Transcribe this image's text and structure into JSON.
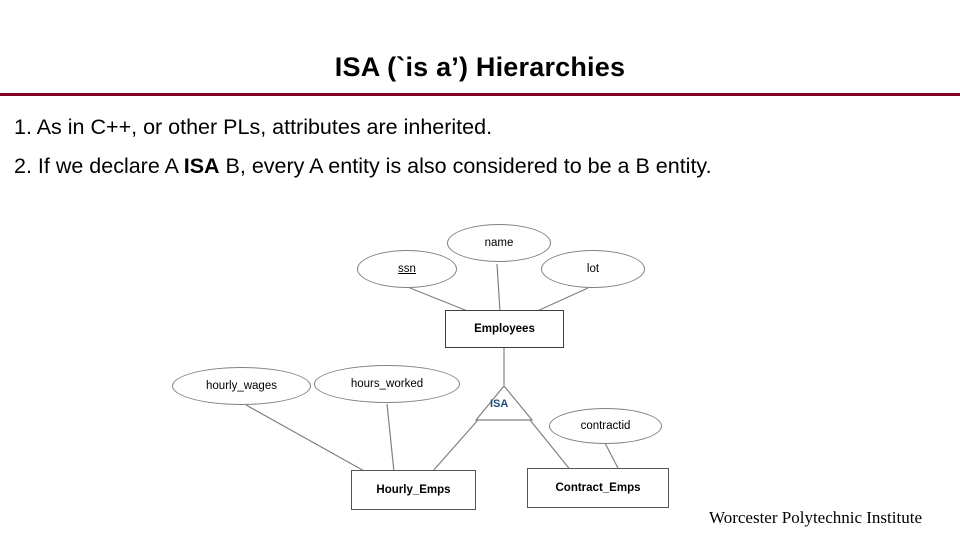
{
  "slide": {
    "title": "ISA (`is a’) Hierarchies",
    "bullets": [
      "1. As in C++, or other PLs, attributes are inherited.",
      "2. If we declare A ISA B, every A entity is also considered to be a B entity."
    ],
    "bullet2_parts": {
      "before": "2. If we declare A ",
      "bold": "ISA",
      "after": " B, every A entity is also considered to be a B entity."
    },
    "footer": "Worcester Polytechnic Institute",
    "accent_color": "#7F0023",
    "isa_label_color": "#1F4E79"
  },
  "diagram": {
    "type": "er-diagram",
    "attributes": [
      {
        "id": "ssn",
        "label": "ssn",
        "shape": "ellipse",
        "key": true
      },
      {
        "id": "name",
        "label": "name",
        "shape": "ellipse",
        "key": false
      },
      {
        "id": "lot",
        "label": "lot",
        "shape": "ellipse",
        "key": false
      },
      {
        "id": "hourly_wages",
        "label": "hourly_wages",
        "shape": "ellipse",
        "key": false
      },
      {
        "id": "hours_worked",
        "label": "hours_worked",
        "shape": "ellipse",
        "key": false
      },
      {
        "id": "contractid",
        "label": "contractid",
        "shape": "ellipse",
        "key": false
      }
    ],
    "entities": [
      {
        "id": "employees",
        "label": "Employees",
        "shape": "rectangle"
      },
      {
        "id": "hourly_emps",
        "label": "Hourly_Emps",
        "shape": "rectangle"
      },
      {
        "id": "contract_emps",
        "label": "Contract_Emps",
        "shape": "rectangle"
      }
    ],
    "relationships": [
      {
        "id": "isa",
        "label": "ISA",
        "shape": "triangle"
      }
    ],
    "edges": [
      {
        "from": "ssn",
        "to": "employees"
      },
      {
        "from": "name",
        "to": "employees"
      },
      {
        "from": "lot",
        "to": "employees"
      },
      {
        "from": "employees",
        "to": "isa"
      },
      {
        "from": "isa",
        "to": "hourly_emps"
      },
      {
        "from": "isa",
        "to": "contract_emps"
      },
      {
        "from": "hourly_wages",
        "to": "hourly_emps"
      },
      {
        "from": "hours_worked",
        "to": "hourly_emps"
      },
      {
        "from": "contractid",
        "to": "contract_emps"
      }
    ]
  }
}
